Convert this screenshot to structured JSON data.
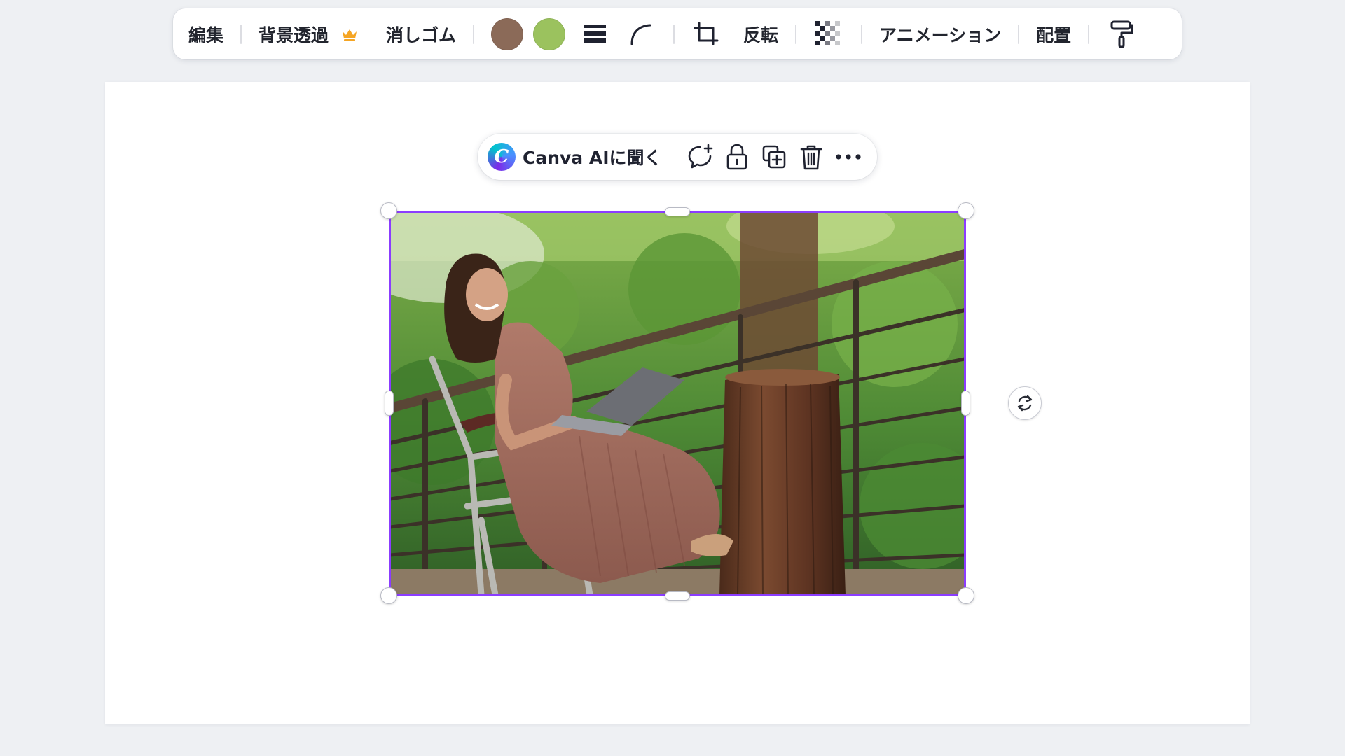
{
  "toolbar": {
    "edit_label": "編集",
    "bg_remove_label": "背景透過",
    "bg_remove_badge_icon": "crown-icon",
    "eraser_label": "消しゴム",
    "colors": [
      "#8b6a58",
      "#9bc25e"
    ],
    "line_weight_icon": "line-weight-icon",
    "corner_rounding_icon": "corner-rounding-icon",
    "crop_icon": "crop-icon",
    "flip_label": "反転",
    "transparency_icon": "transparency-icon",
    "animation_label": "アニメーション",
    "arrange_label": "配置",
    "copy_style_icon": "paint-roller-icon"
  },
  "context_bar": {
    "ai_label": "Canva AIに聞く",
    "ai_logo_letter": "C",
    "comment_icon": "add-comment-icon",
    "lock_icon": "lock-icon",
    "duplicate_icon": "duplicate-icon",
    "delete_icon": "trash-icon",
    "more_icon": "more-icon"
  },
  "selection": {
    "accent_color": "#8b3dff",
    "rotate_icon": "rotate-icon"
  },
  "photo": {
    "subject": "woman-with-laptop-on-chair-by-railing-and-tree-stump"
  }
}
